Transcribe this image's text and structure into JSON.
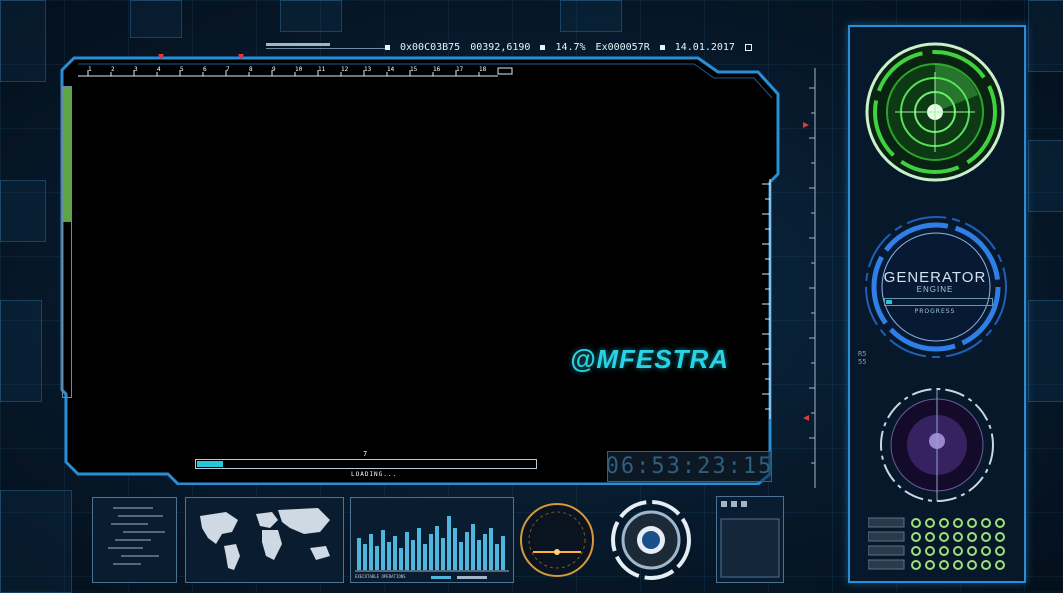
{
  "topbar": {
    "address": "0x00C03B75",
    "coords": "00392,6190",
    "percent": "14.7%",
    "code": "Ex000057R",
    "date": "14.01.2017"
  },
  "ruler_top": [
    "1",
    "2",
    "3",
    "4",
    "5",
    "6",
    "7",
    "8",
    "9",
    "10",
    "11",
    "12",
    "13",
    "14",
    "15",
    "16",
    "17",
    "18"
  ],
  "handle_text": "@MFESTRA",
  "loading": {
    "number": "7",
    "label": "LOADING...",
    "progress": 0.075
  },
  "timer": "06:53:23:15",
  "generator": {
    "title": "GENERATOR",
    "subtitle": "ENGINE",
    "progress_label": "PROGRESS",
    "progress": 0.06
  },
  "side_code": [
    "R5",
    "55"
  ],
  "bottom_panel": {
    "bar_caption": "EXECUTABLE OPERATIONS"
  },
  "colors": {
    "accent": "#27d4e6",
    "frame": "#2a8ed6",
    "radar": "#3fd13f",
    "generator": "#2f7fe6"
  }
}
